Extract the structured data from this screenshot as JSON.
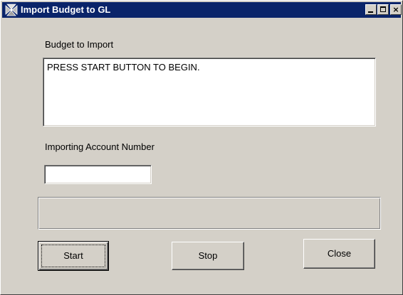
{
  "window": {
    "title": "Import Budget to GL",
    "controls": {
      "minimize_icon": "minimize-icon",
      "maximize_icon": "maximize-icon",
      "close_icon": "close-icon",
      "close_glyph": "×"
    },
    "title_bar_color": "#0a246a",
    "face_color": "#d4d0c8"
  },
  "form": {
    "budget_label": "Budget to Import",
    "budget_text": "PRESS START BUTTON TO BEGIN.",
    "account_label": "Importing Account Number",
    "account_value": "",
    "status_text": ""
  },
  "buttons": {
    "start": "Start",
    "stop": "Stop",
    "close": "Close"
  }
}
